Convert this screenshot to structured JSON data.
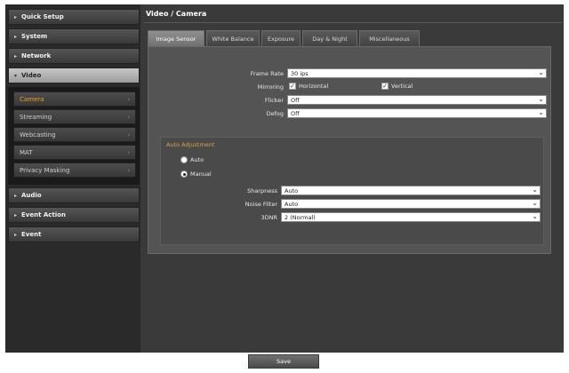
{
  "sidebar": {
    "items": [
      {
        "label": "Quick Setup"
      },
      {
        "label": "System"
      },
      {
        "label": "Network"
      },
      {
        "label": "Video"
      },
      {
        "label": "Audio"
      },
      {
        "label": "Event Action"
      },
      {
        "label": "Event"
      }
    ],
    "video_submenu": [
      {
        "label": "Camera"
      },
      {
        "label": "Streaming"
      },
      {
        "label": "Webcasting"
      },
      {
        "label": "MAT"
      },
      {
        "label": "Privacy Masking"
      }
    ]
  },
  "main": {
    "title": "Video / Camera",
    "tabs": [
      {
        "label": "Image Sensor"
      },
      {
        "label": "White Balance"
      },
      {
        "label": "Exposure"
      },
      {
        "label": "Day & Night"
      },
      {
        "label": "Miscellaneous"
      }
    ],
    "form": {
      "frame_rate": {
        "label": "Frame Rate",
        "value": "30 ips"
      },
      "mirroring": {
        "label": "Mirroring",
        "horizontal": "Horizontal",
        "vertical": "Vertical",
        "horizontal_checked": true,
        "vertical_checked": true
      },
      "flicker": {
        "label": "Flicker",
        "value": "Off"
      },
      "defog": {
        "label": "Defog",
        "value": "Off"
      },
      "auto_adjustment": {
        "title": "Auto Adjustment",
        "auto_label": "Auto",
        "manual_label": "Manual",
        "selected": "Manual",
        "sharpness": {
          "label": "Sharpness",
          "value": "Auto"
        },
        "noise_filter": {
          "label": "Noise Filter",
          "value": "Auto"
        },
        "dnr": {
          "label": "3DNR",
          "value": "2 (Normal)"
        }
      }
    }
  },
  "footer": {
    "save_label": "Save"
  },
  "colors": {
    "accent": "#f0a020",
    "panel": "#545454",
    "background": "#1e1e1e"
  }
}
